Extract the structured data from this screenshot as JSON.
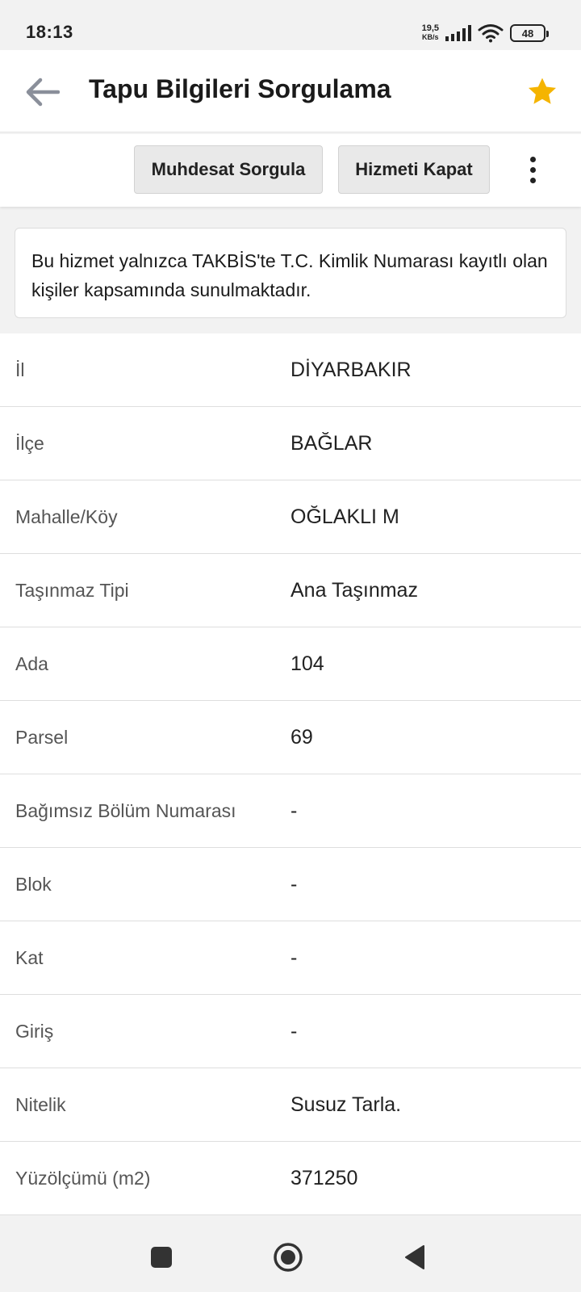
{
  "status_bar": {
    "time": "18:13",
    "net_speed_value": "19,5",
    "net_speed_unit": "KB/s",
    "battery": "48"
  },
  "app_bar": {
    "title": "Tapu Bilgileri Sorgulama",
    "back_icon": "arrow-left-icon",
    "favorite_icon": "star-icon",
    "accent_color": "#f5b400"
  },
  "actions": {
    "muhdesat_label": "Muhdesat Sorgula",
    "kapat_label": "Hizmeti Kapat",
    "more_icon": "more-vertical-icon"
  },
  "notice": {
    "text": "Bu hizmet yalnızca TAKBİS'te T.C. Kimlik Numarası kayıtlı olan kişiler kapsamında sunulmaktadır."
  },
  "rows": [
    {
      "label": "İl",
      "value": "DİYARBAKIR"
    },
    {
      "label": "İlçe",
      "value": "BAĞLAR"
    },
    {
      "label": "Mahalle/Köy",
      "value": "OĞLAKLI M"
    },
    {
      "label": "Taşınmaz Tipi",
      "value": "Ana Taşınmaz"
    },
    {
      "label": "Ada",
      "value": "104"
    },
    {
      "label": "Parsel",
      "value": "69"
    },
    {
      "label": "Bağımsız Bölüm Numarası",
      "value": "-"
    },
    {
      "label": "Blok",
      "value": "-"
    },
    {
      "label": "Kat",
      "value": "-"
    },
    {
      "label": "Giriş",
      "value": "-"
    },
    {
      "label": "Nitelik",
      "value": "Susuz Tarla."
    },
    {
      "label": "Yüzölçümü (m2)",
      "value": "371250"
    }
  ],
  "nav_bar": {
    "recents_icon": "square-icon",
    "home_icon": "circle-icon",
    "back_icon": "triangle-back-icon"
  }
}
